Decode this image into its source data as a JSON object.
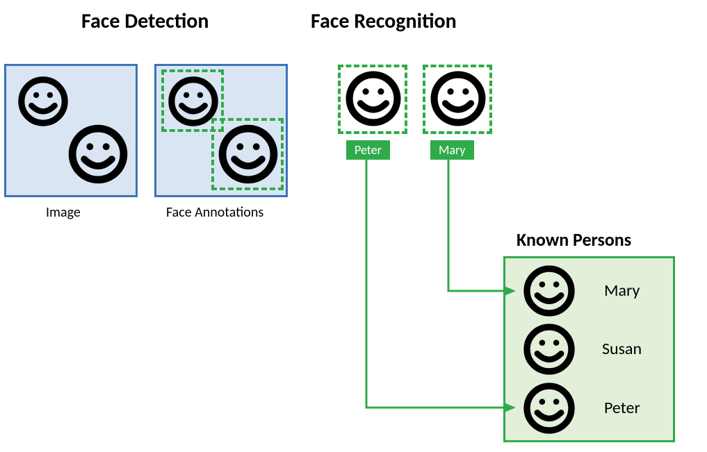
{
  "headings": {
    "face_detection": "Face Detection",
    "face_recognition": "Face Recognition",
    "known_persons": "Known Persons"
  },
  "captions": {
    "image": "Image",
    "face_annotations": "Face Annotations"
  },
  "recognition_labels": {
    "peter": "Peter",
    "mary": "Mary"
  },
  "known_persons": {
    "p1": "Mary",
    "p2": "Susan",
    "p3": "Peter"
  }
}
